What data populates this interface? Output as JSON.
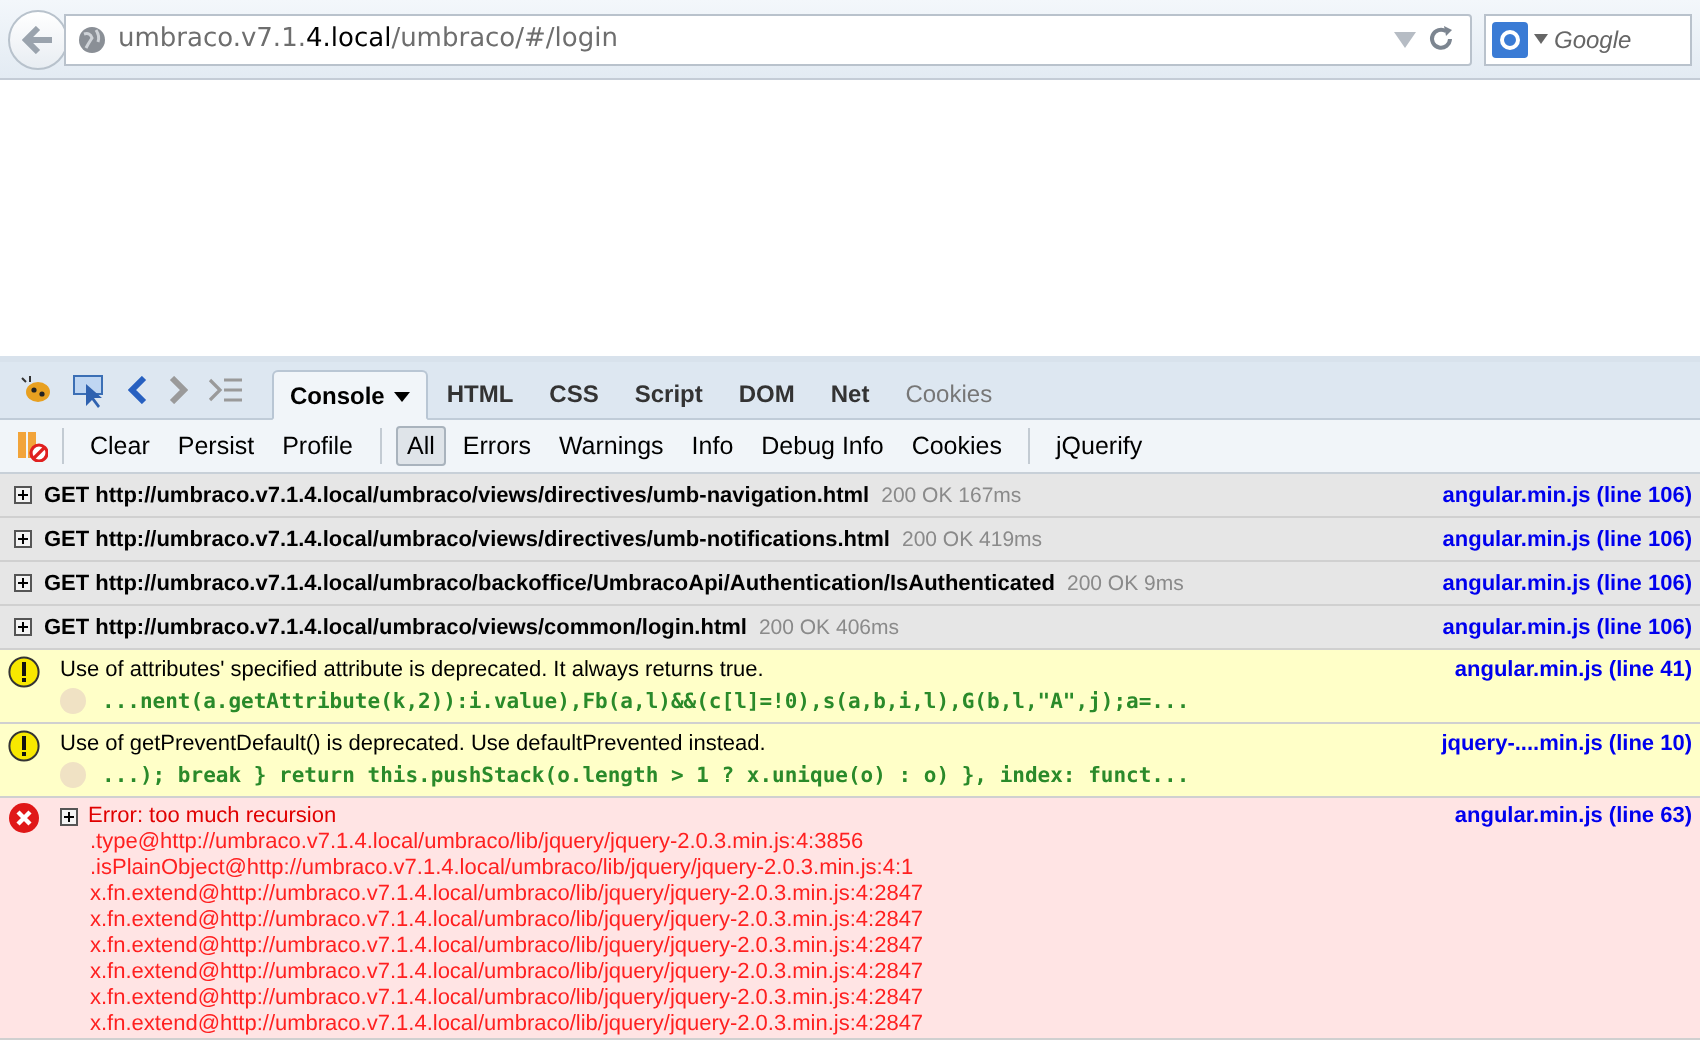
{
  "browser": {
    "url_parts": [
      {
        "text": "umbraco.v7.1.",
        "kind": "dim"
      },
      {
        "text": "4.local",
        "kind": "domain"
      },
      {
        "text": "/umbraco/#/login",
        "kind": "dim"
      }
    ],
    "search_placeholder": "Google"
  },
  "devtools": {
    "panels": [
      {
        "label": "Console",
        "selected": true,
        "disabled": false
      },
      {
        "label": "HTML",
        "selected": false,
        "disabled": false
      },
      {
        "label": "CSS",
        "selected": false,
        "disabled": false
      },
      {
        "label": "Script",
        "selected": false,
        "disabled": false
      },
      {
        "label": "DOM",
        "selected": false,
        "disabled": false
      },
      {
        "label": "Net",
        "selected": false,
        "disabled": false
      },
      {
        "label": "Cookies",
        "selected": false,
        "disabled": true
      }
    ],
    "actions": [
      "Clear",
      "Persist",
      "Profile"
    ],
    "filters": [
      {
        "label": "All",
        "selected": true
      },
      {
        "label": "Errors",
        "selected": false
      },
      {
        "label": "Warnings",
        "selected": false
      },
      {
        "label": "Info",
        "selected": false
      },
      {
        "label": "Debug Info",
        "selected": false
      },
      {
        "label": "Cookies",
        "selected": false
      }
    ],
    "extra_button": "jQuerify",
    "entries": [
      {
        "kind": "request",
        "text": "GET http://umbraco.v7.1.4.local/umbraco/views/directives/umb-navigation.html",
        "status": "200 OK 167ms",
        "source": "angular.min.js (line 106)"
      },
      {
        "kind": "request",
        "text": "GET http://umbraco.v7.1.4.local/umbraco/views/directives/umb-notifications.html",
        "status": "200 OK 419ms",
        "source": "angular.min.js (line 106)"
      },
      {
        "kind": "request",
        "text": "GET http://umbraco.v7.1.4.local/umbraco/backoffice/UmbracoApi/Authentication/IsAuthenticated",
        "status": "200 OK 9ms",
        "source": "angular.min.js (line 106)"
      },
      {
        "kind": "request",
        "text": "GET http://umbraco.v7.1.4.local/umbraco/views/common/login.html",
        "status": "200 OK 406ms",
        "source": "angular.min.js (line 106)"
      },
      {
        "kind": "warning",
        "text": "Use of attributes' specified attribute is deprecated. It always returns true.",
        "code": "...nent(a.getAttribute(k,2)):i.value),Fb(a,l)&&(c[l]=!0),s(a,b,i,l),G(b,l,\"A\",j);a=...",
        "source": "angular.min.js (line 41)"
      },
      {
        "kind": "warning",
        "text": "Use of getPreventDefault() is deprecated. Use defaultPrevented instead.",
        "code": "...); break } return this.pushStack(o.length > 1 ? x.unique(o) : o) }, index: funct...",
        "source": "jquery-....min.js (line 10)"
      },
      {
        "kind": "error",
        "text": "Error: too much recursion",
        "source": "angular.min.js (line 63)",
        "stack": [
          ".type@http://umbraco.v7.1.4.local/umbraco/lib/jquery/jquery-2.0.3.min.js:4:3856",
          ".isPlainObject@http://umbraco.v7.1.4.local/umbraco/lib/jquery/jquery-2.0.3.min.js:4:1",
          "x.fn.extend@http://umbraco.v7.1.4.local/umbraco/lib/jquery/jquery-2.0.3.min.js:4:2847",
          "x.fn.extend@http://umbraco.v7.1.4.local/umbraco/lib/jquery/jquery-2.0.3.min.js:4:2847",
          "x.fn.extend@http://umbraco.v7.1.4.local/umbraco/lib/jquery/jquery-2.0.3.min.js:4:2847",
          "x.fn.extend@http://umbraco.v7.1.4.local/umbraco/lib/jquery/jquery-2.0.3.min.js:4:2847",
          "x.fn.extend@http://umbraco.v7.1.4.local/umbraco/lib/jquery/jquery-2.0.3.min.js:4:2847",
          "x.fn.extend@http://umbraco.v7.1.4.local/umbraco/lib/jquery/jquery-2.0.3.min.js:4:2847"
        ]
      }
    ]
  }
}
